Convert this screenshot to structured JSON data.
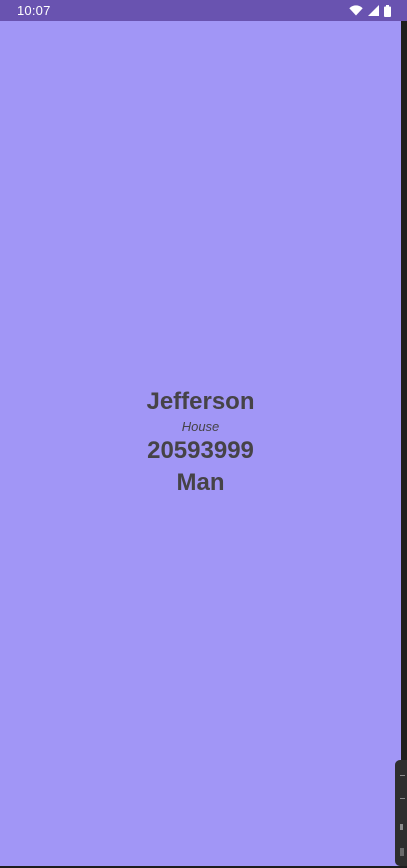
{
  "status_bar": {
    "time": "10:07",
    "icons": [
      "wifi-icon",
      "signal-icon",
      "battery-icon"
    ]
  },
  "card": {
    "name": "Jefferson",
    "type": "House",
    "number": "20593999",
    "gender": "Man"
  },
  "colors": {
    "status_bar_bg": "#6953b0",
    "screen_bg": "#a196f6",
    "text": "#464347"
  }
}
